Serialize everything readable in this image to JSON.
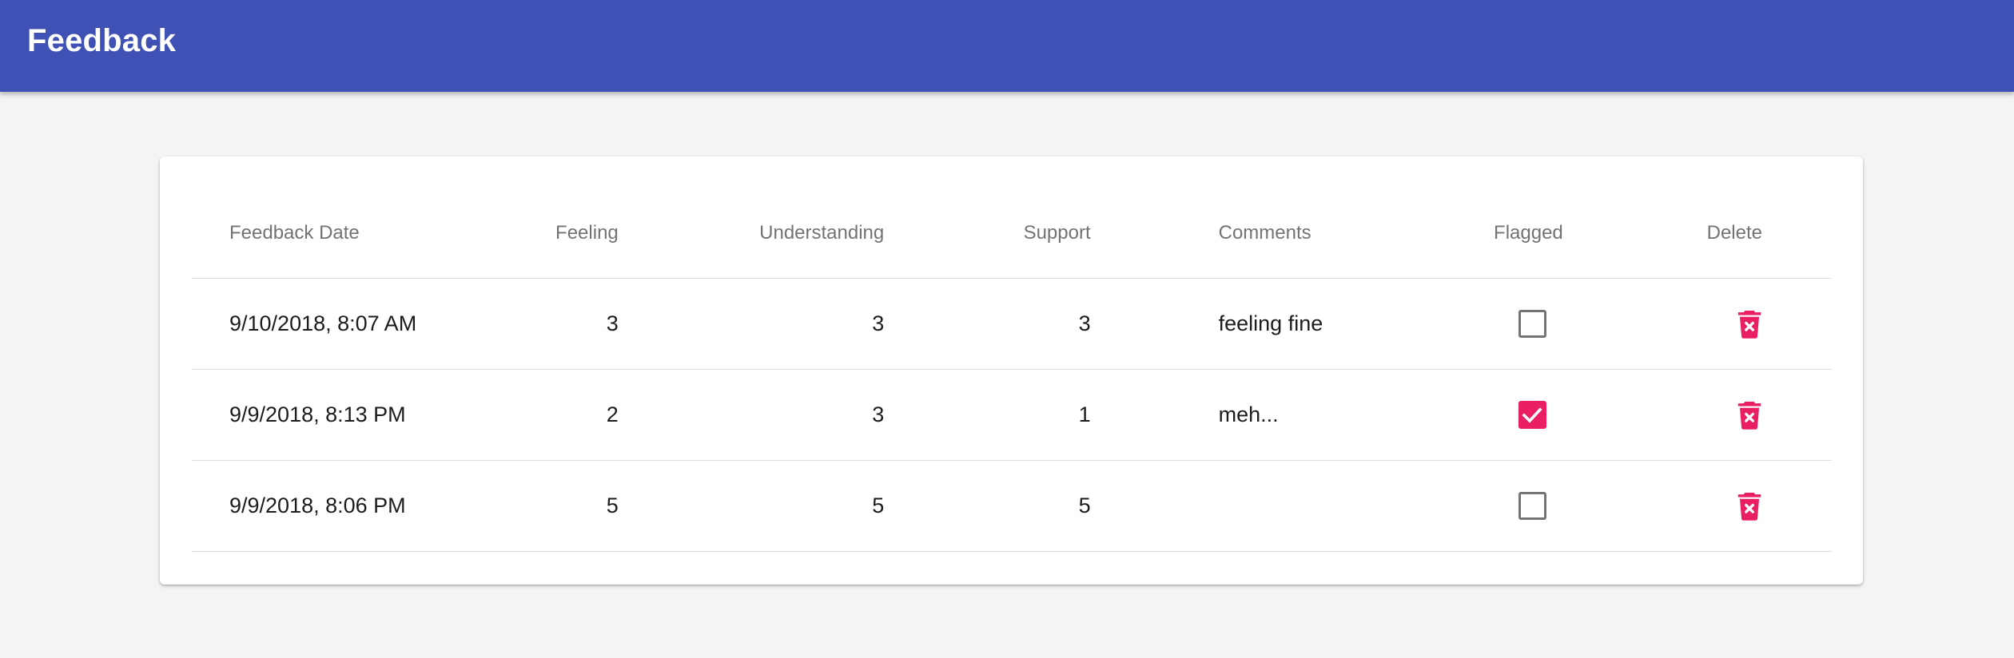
{
  "app": {
    "title": "Feedback"
  },
  "colors": {
    "app_bar": "#3f51b5",
    "accent": "#e91e63",
    "background": "#f4f4f4"
  },
  "table": {
    "headers": {
      "date": "Feedback Date",
      "feeling": "Feeling",
      "understanding": "Understanding",
      "support": "Support",
      "comments": "Comments",
      "flagged": "Flagged",
      "delete": "Delete"
    },
    "rows": [
      {
        "date": "9/10/2018, 8:07 AM",
        "feeling": "3",
        "understanding": "3",
        "support": "3",
        "comments": "feeling fine",
        "flagged": false,
        "delete_icon": "delete-forever-icon"
      },
      {
        "date": "9/9/2018, 8:13 PM",
        "feeling": "2",
        "understanding": "3",
        "support": "1",
        "comments": "meh...",
        "flagged": true,
        "delete_icon": "delete-forever-icon"
      },
      {
        "date": "9/9/2018, 8:06 PM",
        "feeling": "5",
        "understanding": "5",
        "support": "5",
        "comments": "",
        "flagged": false,
        "delete_icon": "delete-forever-icon"
      }
    ]
  }
}
